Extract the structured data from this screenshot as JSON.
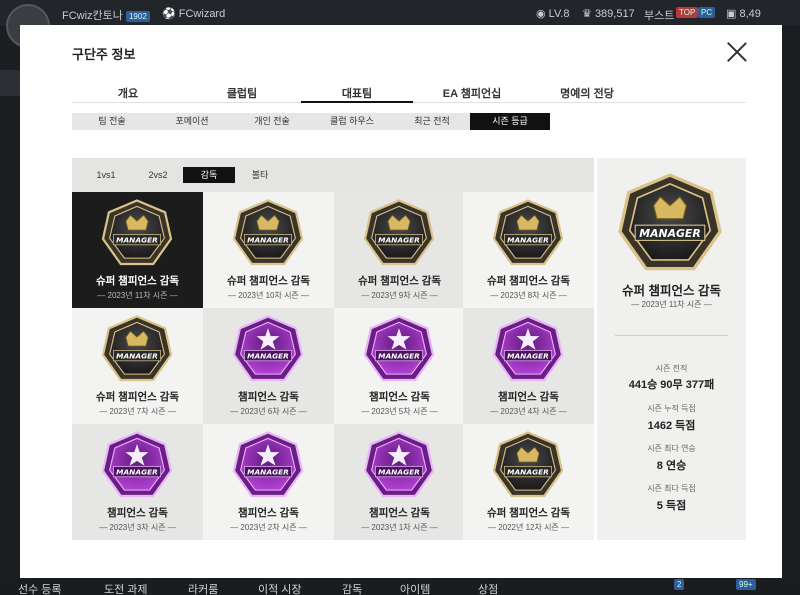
{
  "topbar": {
    "username": "FCwiz칸토나",
    "user_badge": "1902",
    "coach_name": "FCwizard",
    "level": "LV.8",
    "points": "389,517",
    "boost_label": "부스트",
    "tag_top": "TOP",
    "tag_pc": "PC",
    "cash": "8,49"
  },
  "bottombar": {
    "items": [
      "선수 등록",
      "도전 과제",
      "라커룸",
      "이적 시장",
      "감독",
      "아이템",
      "상점"
    ],
    "badge1": "2",
    "badge2": "99+"
  },
  "modal": {
    "title": "구단주 정보",
    "main_tabs": [
      "개요",
      "클럽팀",
      "대표팀",
      "EA 챔피언십",
      "명예의 전당"
    ],
    "active_main_tab": 2,
    "sub_tabs": [
      "팀 전술",
      "포메이션",
      "개인 전술",
      "클럽 하우스",
      "최근 전적",
      "시즌 등급"
    ],
    "active_sub_tab": 5,
    "mode_tabs": [
      "1vs1",
      "2vs2",
      "감독",
      "볼타"
    ],
    "active_mode_tab": 2
  },
  "colors": {
    "gold_badge": "#c9a24a",
    "purple_badge": "#9b2fbf",
    "selected_cell": "#1c1c1c"
  },
  "grades": [
    {
      "name": "슈퍼 챔피언스 감독",
      "season": "2023년 11차 시즌",
      "badge": "gold",
      "selected": true
    },
    {
      "name": "슈퍼 챔피언스 감독",
      "season": "2023년 10차 시즌",
      "badge": "gold"
    },
    {
      "name": "슈퍼 챔피언스 감독",
      "season": "2023년 9차 시즌",
      "badge": "gold"
    },
    {
      "name": "슈퍼 챔피언스 감독",
      "season": "2023년 8차 시즌",
      "badge": "gold"
    },
    {
      "name": "슈퍼 챔피언스 감독",
      "season": "2023년 7차 시즌",
      "badge": "gold"
    },
    {
      "name": "챔피언스 감독",
      "season": "2023년 6차 시즌",
      "badge": "purple"
    },
    {
      "name": "챔피언스 감독",
      "season": "2023년 5차 시즌",
      "badge": "purple"
    },
    {
      "name": "챔피언스 감독",
      "season": "2023년 4차 시즌",
      "badge": "purple"
    },
    {
      "name": "챔피언스 감독",
      "season": "2023년 3차 시즌",
      "badge": "purple"
    },
    {
      "name": "챔피언스 감독",
      "season": "2023년 2차 시즌",
      "badge": "purple"
    },
    {
      "name": "챔피언스 감독",
      "season": "2023년 1차 시즌",
      "badge": "purple"
    },
    {
      "name": "슈퍼 챔피언스 감독",
      "season": "2022년 12차 시즌",
      "badge": "gold"
    }
  ],
  "badge_text": "MANAGER",
  "detail": {
    "name": "슈퍼 챔피언스 감독",
    "season": "2023년 11차 시즌",
    "stats": [
      {
        "label": "시즌 전적",
        "value": "441승 90무 377패"
      },
      {
        "label": "시즌 누적 득점",
        "value": "1462 득점"
      },
      {
        "label": "시즌 최다 연승",
        "value": "8 연승"
      },
      {
        "label": "시즌 최다 득점",
        "value": "5 득점"
      }
    ]
  }
}
